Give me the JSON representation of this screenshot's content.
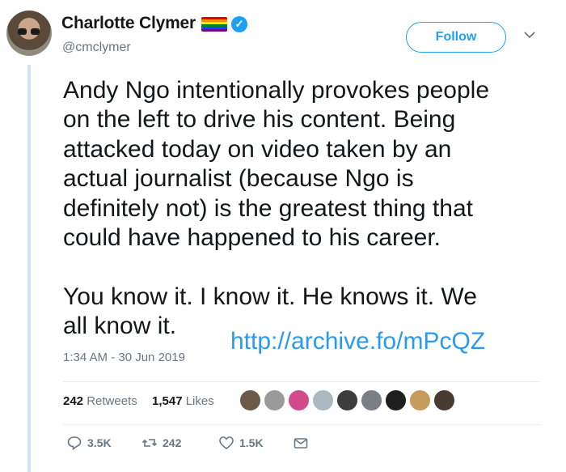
{
  "author": {
    "name": "Charlotte Clymer",
    "handle": "@cmclymer",
    "flag_colors": [
      "#e40303",
      "#ff8c00",
      "#ffed00",
      "#008026",
      "#004dff",
      "#750787"
    ]
  },
  "follow_label": "Follow",
  "tweet": {
    "text": "Andy Ngo intentionally provokes people\non the left to drive his content. Being\nattacked today on video taken by an\nactual journalist (because Ngo is\ndefinitely not) is the greatest thing that\ncould have happened to his career.\n\nYou know it. I know it. He knows it. We\nall know it.",
    "overlay_link": "http://archive.fo/mPcQZ",
    "timestamp": "1:34 AM - 30 Jun 2019"
  },
  "stats": {
    "retweets_count": "242",
    "retweets_label": "Retweets",
    "likes_count": "1,547",
    "likes_label": "Likes"
  },
  "actions": {
    "reply_count": "3.5K",
    "retweet_count": "242",
    "like_count": "1.5K"
  },
  "colors": {
    "accent": "#1da1f2",
    "link": "#2b9aee",
    "muted": "#657786",
    "thread_line": "#cfe3f3"
  }
}
